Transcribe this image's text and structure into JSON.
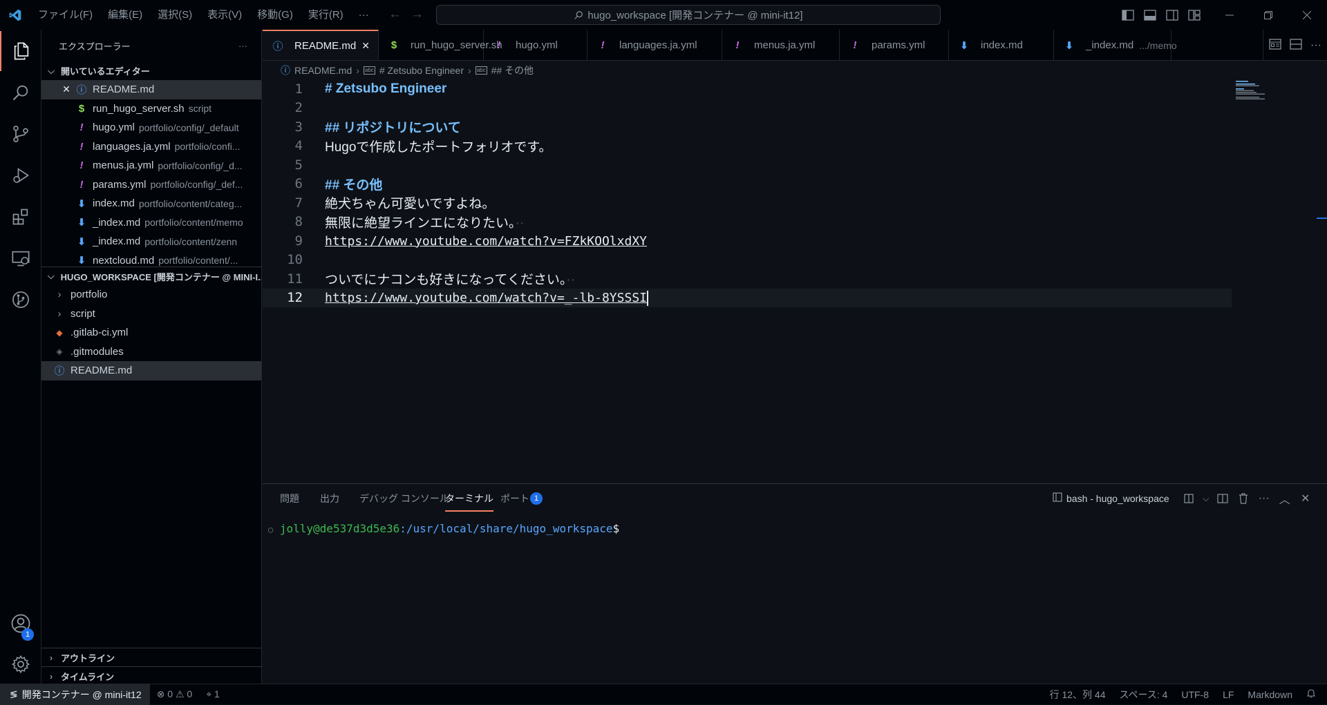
{
  "menu": [
    "ファイル(F)",
    "編集(E)",
    "選択(S)",
    "表示(V)",
    "移動(G)",
    "実行(R)",
    "···"
  ],
  "command_center": "hugo_workspace [開発コンテナー @ mini-it12]",
  "activity": {
    "accounts_badge": "1"
  },
  "explorer": {
    "title": "エクスプローラー",
    "more": "···",
    "open_editors_label": "開いているエディター",
    "open_editors": [
      {
        "name": "README.md",
        "desc": "",
        "icon": "info-icon"
      },
      {
        "name": "run_hugo_server.sh",
        "desc": "script",
        "icon": "$"
      },
      {
        "name": "hugo.yml",
        "desc": "portfolio/config/_default",
        "icon": "!"
      },
      {
        "name": "languages.ja.yml",
        "desc": "portfolio/confi...",
        "icon": "!"
      },
      {
        "name": "menus.ja.yml",
        "desc": "portfolio/config/_d...",
        "icon": "!"
      },
      {
        "name": "params.yml",
        "desc": "portfolio/config/_def...",
        "icon": "!"
      },
      {
        "name": "index.md",
        "desc": "portfolio/content/categ...",
        "icon": "md"
      },
      {
        "name": "_index.md",
        "desc": "portfolio/content/memo",
        "icon": "md"
      },
      {
        "name": "_index.md",
        "desc": "portfolio/content/zenn",
        "icon": "md"
      },
      {
        "name": "nextcloud.md",
        "desc": "portfolio/content/...",
        "icon": "md"
      }
    ],
    "workspace_label": "HUGO_WORKSPACE [開発コンテナー @ MINI-I...",
    "tree": [
      {
        "name": "portfolio",
        "type": "folder"
      },
      {
        "name": "script",
        "type": "folder"
      },
      {
        "name": ".gitlab-ci.yml",
        "type": "gitlab"
      },
      {
        "name": ".gitmodules",
        "type": "git"
      },
      {
        "name": "README.md",
        "type": "info"
      }
    ],
    "outline_label": "アウトライン",
    "timeline_label": "タイムライン"
  },
  "tabs": [
    {
      "label": "README.md",
      "desc": "",
      "icon": "info"
    },
    {
      "label": "run_hugo_server.sh",
      "desc": "",
      "icon": "$"
    },
    {
      "label": "hugo.yml",
      "desc": "",
      "icon": "!"
    },
    {
      "label": "languages.ja.yml",
      "desc": "",
      "icon": "!"
    },
    {
      "label": "menus.ja.yml",
      "desc": "",
      "icon": "!"
    },
    {
      "label": "params.yml",
      "desc": "",
      "icon": "!"
    },
    {
      "label": "index.md",
      "desc": "",
      "icon": "md"
    },
    {
      "label": "_index.md",
      "desc": ".../memo",
      "icon": "md"
    }
  ],
  "breadcrumb": [
    "README.md",
    "# Zetsubo Engineer",
    "## その他"
  ],
  "editor": {
    "current_line": 12,
    "lines": [
      {
        "n": "1",
        "text": "# Zetsubo Engineer",
        "kind": "h"
      },
      {
        "n": "2",
        "text": "",
        "kind": "t"
      },
      {
        "n": "3",
        "text": "## リポジトリについて",
        "kind": "h"
      },
      {
        "n": "4",
        "text": "Hugoで作成したポートフォリオです。",
        "kind": "t"
      },
      {
        "n": "5",
        "text": "",
        "kind": "t"
      },
      {
        "n": "6",
        "text": "## その他",
        "kind": "h"
      },
      {
        "n": "7",
        "text": "絶犬ちゃん可愛いですよね。",
        "kind": "t"
      },
      {
        "n": "8",
        "text": "無限に絶望ラインエになりたい。",
        "kind": "t",
        "trail": "··"
      },
      {
        "n": "9",
        "text": "https://www.youtube.com/watch?v=FZkKOOlxdXY",
        "kind": "url"
      },
      {
        "n": "10",
        "text": "",
        "kind": "t"
      },
      {
        "n": "11",
        "text": "ついでにナコンも好きになってください。",
        "kind": "t",
        "trail": "··"
      },
      {
        "n": "12",
        "text": "https://www.youtube.com/watch?v=_-lb-8YSSSI",
        "kind": "url"
      }
    ]
  },
  "panel": {
    "tabs": [
      "問題",
      "出力",
      "デバッグ コンソール",
      "ターミナル",
      "ポート"
    ],
    "ports_badge": "1",
    "terminal_name": "bash - hugo_workspace",
    "prompt_user": "jolly@de537d3d5e36",
    "prompt_path": ":/usr/local/share/hugo_workspace",
    "prompt_symbol": "$"
  },
  "status": {
    "remote": "開発コンテナー @ mini-it12",
    "errors": "0",
    "warnings": "0",
    "ports": "1",
    "position": "行 12、列 44",
    "spaces": "スペース: 4",
    "encoding": "UTF-8",
    "eol": "LF",
    "language": "Markdown"
  },
  "colors": {
    "accent": "#f78166",
    "badge": "#1f6feb",
    "heading": "#79c0ff",
    "prompt_user": "#3fb950",
    "prompt_path": "#58a6ff"
  }
}
